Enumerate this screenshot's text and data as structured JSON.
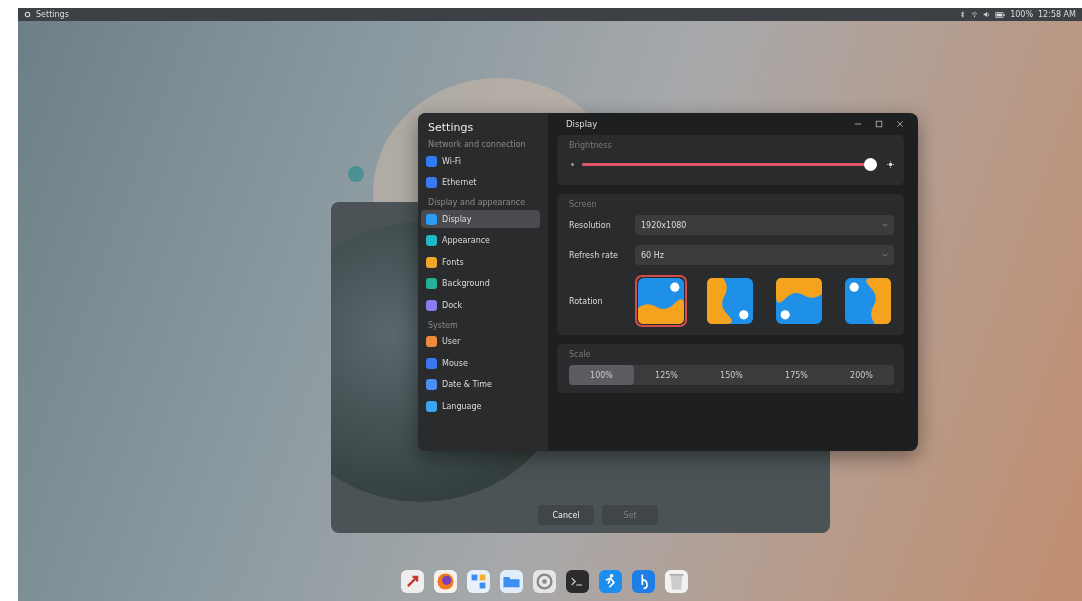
{
  "top_bar": {
    "app_title": "Settings",
    "battery": "100%",
    "time": "12:58 AM"
  },
  "background_dialog": {
    "buttons": [
      {
        "label": "Cancel",
        "disabled": false
      },
      {
        "label": "Set",
        "disabled": true
      }
    ]
  },
  "window": {
    "sidebar_title": "Settings",
    "title": "Display",
    "sidebar": [
      {
        "heading": "Network and connection",
        "items": [
          {
            "label": "Wi-Fi",
            "color": "#2f7cf6",
            "selected": false
          },
          {
            "label": "Ethernet",
            "color": "#3a7af0",
            "selected": false
          }
        ]
      },
      {
        "heading": "Display and appearance",
        "items": [
          {
            "label": "Display",
            "color": "#2a9df4",
            "selected": true
          },
          {
            "label": "Appearance",
            "color": "#1fb8c8",
            "selected": false
          },
          {
            "label": "Fonts",
            "color": "#f2a72c",
            "selected": false
          },
          {
            "label": "Background",
            "color": "#27b09a",
            "selected": false
          },
          {
            "label": "Dock",
            "color": "#8b7cf0",
            "selected": false
          }
        ]
      },
      {
        "heading": "System",
        "items": [
          {
            "label": "User",
            "color": "#ef8a3c",
            "selected": false
          },
          {
            "label": "Mouse",
            "color": "#3b78f0",
            "selected": false
          },
          {
            "label": "Date & Time",
            "color": "#4a8ef5",
            "selected": false
          },
          {
            "label": "Language",
            "color": "#3aa6f2",
            "selected": false
          }
        ]
      }
    ],
    "brightness": {
      "heading": "Brightness",
      "level": 1.0
    },
    "screen": {
      "heading": "Screen",
      "resolution": {
        "label": "Resolution",
        "value": "1920x1080"
      },
      "refresh_rate": {
        "label": "Refresh rate",
        "value": "60 Hz"
      },
      "rotation": {
        "label": "Rotation",
        "options": [
          {
            "kind": "normal",
            "selected": true
          },
          {
            "kind": "right",
            "selected": false
          },
          {
            "kind": "inverted",
            "selected": false
          },
          {
            "kind": "left",
            "selected": false
          }
        ]
      }
    },
    "scale": {
      "heading": "Scale",
      "options": [
        {
          "label": "100%",
          "selected": true
        },
        {
          "label": "125%",
          "selected": false
        },
        {
          "label": "150%",
          "selected": false
        },
        {
          "label": "175%",
          "selected": false
        },
        {
          "label": "200%",
          "selected": false
        }
      ]
    }
  }
}
